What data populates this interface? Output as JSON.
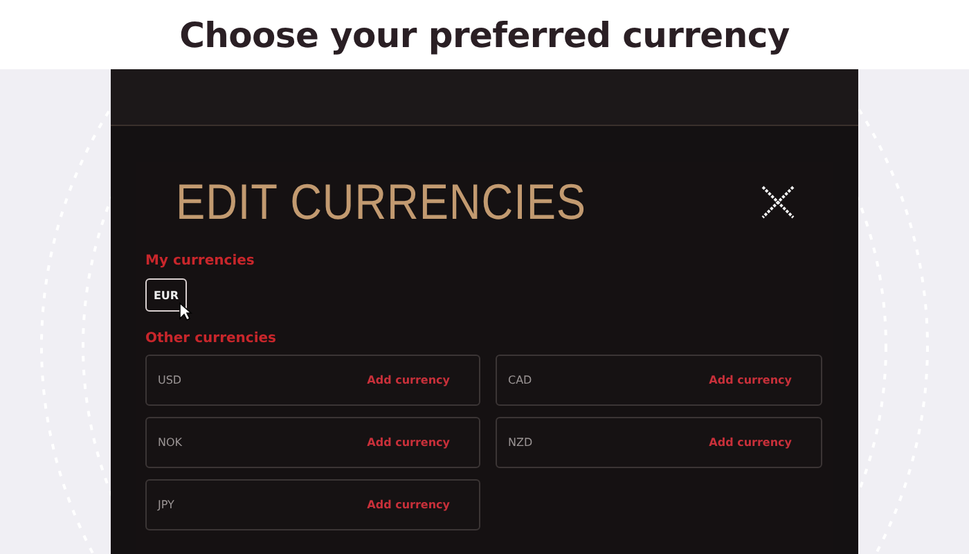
{
  "banner": {
    "title": "Choose your **preferred currency**"
  },
  "modal": {
    "title": "EDIT CURRENCIES",
    "my_currencies": {
      "label": "My currencies",
      "items": [
        {
          "code": "EUR"
        }
      ]
    },
    "other_currencies": {
      "label": "Other currencies",
      "items": [
        {
          "code": "USD",
          "action": "Add currency"
        },
        {
          "code": "CAD",
          "action": "Add currency"
        },
        {
          "code": "NOK",
          "action": "Add currency"
        },
        {
          "code": "NZD",
          "action": "Add currency"
        },
        {
          "code": "JPY",
          "action": "Add currency"
        }
      ]
    }
  }
}
